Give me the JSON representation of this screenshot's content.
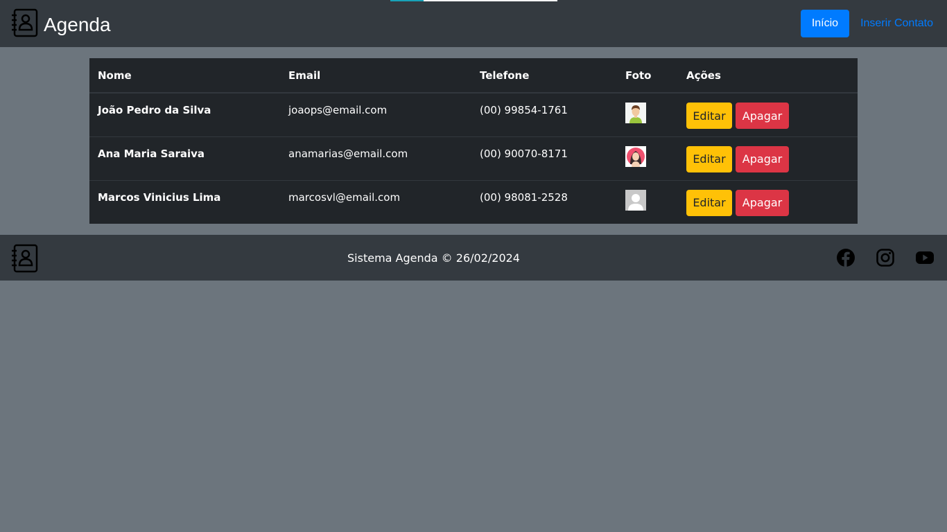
{
  "header": {
    "brand_title": "Agenda",
    "brand_icon": "contact-book-icon",
    "nav": {
      "home_label": "Início",
      "insert_label": "Inserir Contato"
    },
    "loading_progress": 0.2
  },
  "table": {
    "columns": [
      "Nome",
      "Email",
      "Telefone",
      "Foto",
      "Ações"
    ],
    "rows": [
      {
        "nome": "João Pedro da Silva",
        "email": "joaops@email.com",
        "telefone": "(00) 99854-1761",
        "foto": "male-avatar"
      },
      {
        "nome": "Ana Maria Saraiva",
        "email": "anamarias@email.com",
        "telefone": "(00) 90070-8171",
        "foto": "female-avatar"
      },
      {
        "nome": "Marcos Vinicius Lima",
        "email": "marcosvl@email.com",
        "telefone": "(00) 98081-2528",
        "foto": "default-avatar"
      }
    ],
    "edit_label": "Editar",
    "delete_label": "Apagar"
  },
  "footer": {
    "text": "Sistema Agenda © 26/02/2024",
    "social": [
      "facebook-icon",
      "instagram-icon",
      "youtube-icon"
    ]
  },
  "colors": {
    "background": "#6c757d",
    "navbar": "#343a40",
    "table": "#212529",
    "primary": "#007bff",
    "warning": "#ffc107",
    "danger": "#dc3545"
  }
}
